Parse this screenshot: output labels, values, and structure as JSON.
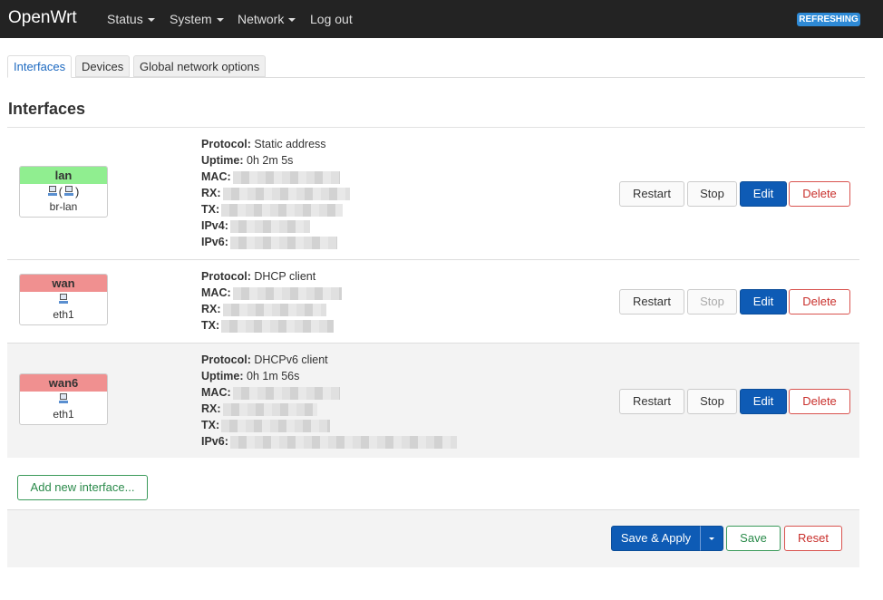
{
  "app": {
    "brand": "OpenWrt",
    "status_badge": "REFRESHING"
  },
  "nav": [
    {
      "label": "Status"
    },
    {
      "label": "System"
    },
    {
      "label": "Network"
    },
    {
      "label": "Log out"
    }
  ],
  "tabs": [
    {
      "label": "Interfaces",
      "active": true
    },
    {
      "label": "Devices"
    },
    {
      "label": "Global network options"
    }
  ],
  "section_title": "Interfaces",
  "interfaces": [
    {
      "name": "lan",
      "status_color": "#90ee90",
      "device": "br-lan",
      "icons": [
        "network-port-icon",
        "network-port-icon"
      ],
      "fields": [
        {
          "label": "Protocol:",
          "value": "Static address"
        },
        {
          "label": "Uptime:",
          "value": "0h 2m 5s"
        },
        {
          "label": "MAC:",
          "value": ""
        },
        {
          "label": "RX:",
          "value": ""
        },
        {
          "label": "TX:",
          "value": ""
        },
        {
          "label": "IPv4:",
          "value": ""
        },
        {
          "label": "IPv6:",
          "value": ""
        }
      ],
      "buttons": {
        "restart": "Restart",
        "stop": "Stop",
        "edit": "Edit",
        "delete": "Delete"
      }
    },
    {
      "name": "wan",
      "status_color": "#f09090",
      "device": "eth1",
      "icons": [
        "network-port-icon"
      ],
      "fields": [
        {
          "label": "Protocol:",
          "value": "DHCP client"
        },
        {
          "label": "MAC:",
          "value": ""
        },
        {
          "label": "RX:",
          "value": ""
        },
        {
          "label": "TX:",
          "value": ""
        }
      ],
      "buttons": {
        "restart": "Restart",
        "stop": "Stop",
        "edit": "Edit",
        "delete": "Delete"
      }
    },
    {
      "name": "wan6",
      "status_color": "#f09090",
      "device": "eth1",
      "icons": [
        "network-port-icon"
      ],
      "fields": [
        {
          "label": "Protocol:",
          "value": "DHCPv6 client"
        },
        {
          "label": "Uptime:",
          "value": "0h 1m 56s"
        },
        {
          "label": "MAC:",
          "value": ""
        },
        {
          "label": "RX:",
          "value": ""
        },
        {
          "label": "TX:",
          "value": ""
        },
        {
          "label": "IPv6:",
          "value": ""
        }
      ],
      "buttons": {
        "restart": "Restart",
        "stop": "Stop",
        "edit": "Edit",
        "delete": "Delete"
      }
    }
  ],
  "add_interface_label": "Add new interface...",
  "footer": {
    "save_apply": "Save & Apply",
    "save": "Save",
    "reset": "Reset"
  },
  "colors": {
    "navbar": "#232323",
    "primary": "#0e5bb5",
    "danger": "#d9534f",
    "success": "#3a9a5a",
    "active_tab": "#1e6ac1"
  }
}
